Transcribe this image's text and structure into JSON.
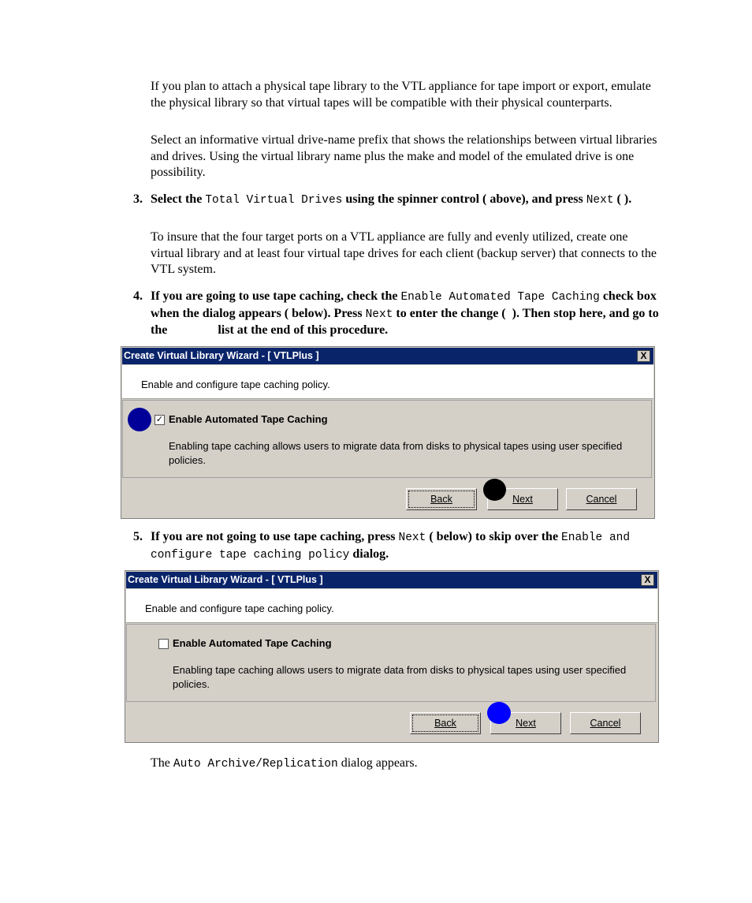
{
  "intro": {
    "para1": "If you plan to attach a physical tape library to the VTL appliance for tape import or export, emulate the physical library so that virtual tapes will be compatible with their physical counterparts.",
    "para2": "Select an informative virtual drive-name prefix that shows the relationships between virtual libraries and drives. Using the virtual library name plus the make and model of the emulated drive is one possibility."
  },
  "step3": {
    "number": "3.",
    "t1": "Select the ",
    "c1": "Total Virtual Drives",
    "t2": " using the spinner control (   above), and press ",
    "c2": "Next",
    "t3": " (   ).",
    "para": "To insure that the four target ports on a VTL appliance are fully and evenly utilized, create one virtual library and at least four virtual tape drives for each client (backup server) that connects to the VTL system."
  },
  "step4": {
    "number": "4.",
    "t1": "If you are going to use tape caching, check the ",
    "c1": "Enable Automated Tape Caching",
    "t2": " check box when the dialog appears (   below). Press ",
    "c2": "Next",
    "t3": " to enter the change (  ). Then stop here, and go to the                list at the end of this procedure."
  },
  "step5": {
    "number": "5.",
    "t1": "If you are not going to use tape caching, press ",
    "c1": "Next",
    "t2": " (   below) to skip over the ",
    "c2": "Enable and configure tape caching policy",
    "t3": " dialog."
  },
  "dialog": {
    "title": "Create Virtual Library Wizard - [ VTLPlus ]",
    "close": "X",
    "header": "Enable and configure tape caching policy.",
    "checkbox_label": "Enable Automated Tape Caching",
    "description": "Enabling tape caching allows users to migrate data from disks to physical tapes using user specified policies.",
    "back": "Back",
    "next": "Next",
    "cancel": "Cancel"
  },
  "dialog1_checked": true,
  "dialog2_checked": false,
  "callout_colors": {
    "blue": "#000099",
    "black": "#000000",
    "bright_blue": "#0000ff"
  },
  "closing": {
    "t1": "The ",
    "c1": "Auto Archive/Replication",
    "t2": " dialog appears."
  }
}
